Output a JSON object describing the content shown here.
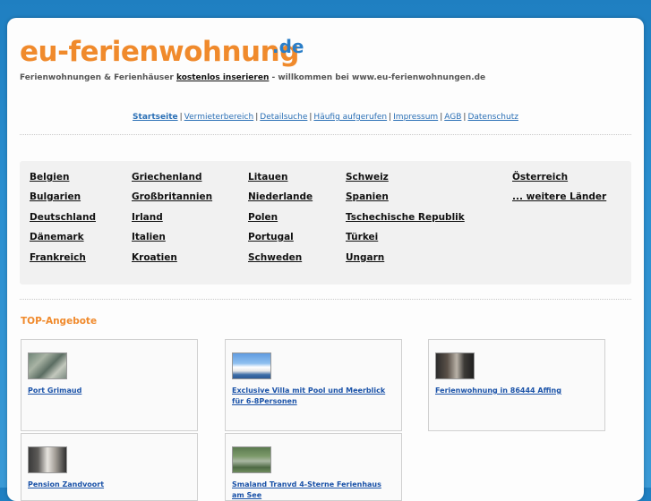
{
  "logo": {
    "main": "eu-ferienwohnung",
    "tld": ".de"
  },
  "tagline": {
    "part1": "Ferienwohnungen & Ferienhäuser ",
    "link": "kostenlos inserieren",
    "part2": " - willkommen bei www.eu-ferienwohnungen.de"
  },
  "nav": [
    {
      "label": "Startseite"
    },
    {
      "label": "Vermieterbereich"
    },
    {
      "label": "Detailsuche"
    },
    {
      "label": "Häufig aufgerufen"
    },
    {
      "label": "Impressum"
    },
    {
      "label": "AGB"
    },
    {
      "label": "Datenschutz"
    }
  ],
  "countries": [
    [
      "Belgien",
      "Bulgarien",
      "Deutschland",
      "Dänemark",
      "Frankreich"
    ],
    [
      "Griechenland",
      "Großbritannien",
      "Irland",
      "Italien",
      "Kroatien"
    ],
    [
      "Litauen",
      "Niederlande",
      "Polen",
      "Portugal",
      "Schweden"
    ],
    [
      "Schweiz",
      "Spanien",
      "Tschechische Republik",
      "Türkei",
      "Ungarn"
    ],
    [
      "Österreich",
      "... weitere Länder"
    ]
  ],
  "top_offers": {
    "heading": "TOP-Angebote",
    "items": [
      {
        "title": "Port Grimaud",
        "thumb": "aerial-harbor"
      },
      {
        "title": "Exclusive Villa mit Pool und Meerblick für 6-8Personen",
        "thumb": "villa-pool"
      },
      {
        "title": "Ferienwohnung in 86444 Affing",
        "thumb": "interior-room"
      },
      {
        "title": "Pension Zandvoort",
        "thumb": "room-window"
      },
      {
        "title": "Smaland Tranvd 4-Sterne Ferienhaus am See",
        "thumb": "forest-cabin"
      }
    ]
  },
  "colors": {
    "brand_orange": "#f08a2c",
    "brand_blue": "#2a7ec8",
    "link_blue": "#1a52a8",
    "background_blue": "#2a8fd0"
  }
}
